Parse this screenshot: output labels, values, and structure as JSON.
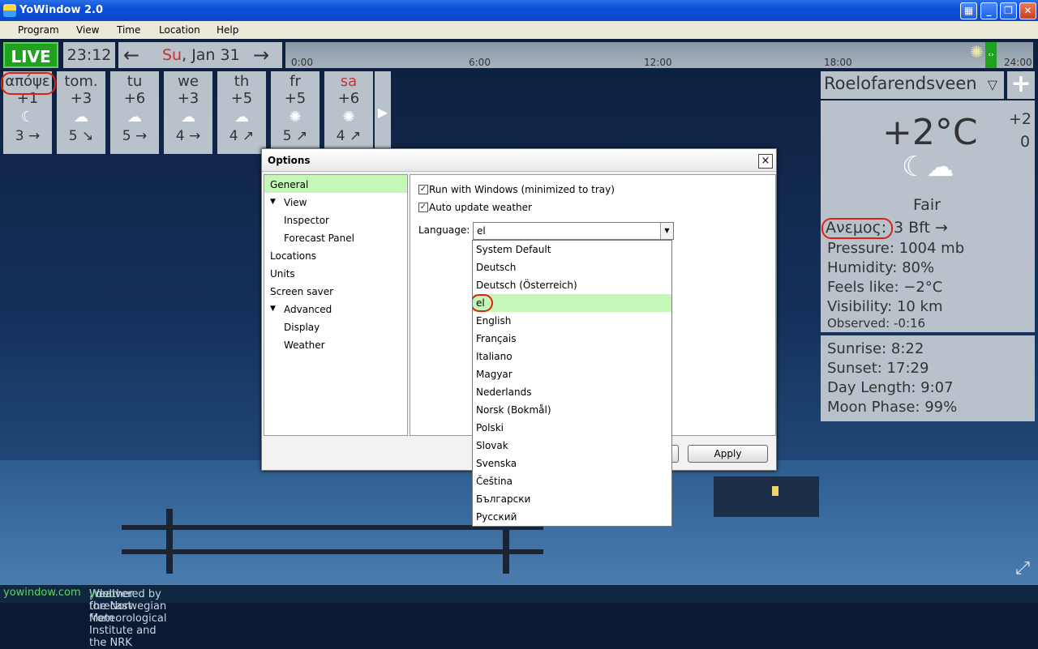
{
  "window": {
    "title": "YoWindow 2.0",
    "minimize": "_",
    "maximize": "❐",
    "close": "✕"
  },
  "menu": [
    "Program",
    "View",
    "Time",
    "Location",
    "Help"
  ],
  "timebar": {
    "live": "LIVE",
    "clock": "23:12",
    "day": "Su",
    "date": ", Jan 31",
    "prev": "←",
    "next": "→",
    "ticks": [
      "0:00",
      "6:00",
      "12:00",
      "18:00",
      "24:00"
    ]
  },
  "forecast": [
    {
      "day": "απόψε",
      "temp": "+1",
      "icon": "☾",
      "wind": "3 →"
    },
    {
      "day": "tom.",
      "temp": "+3",
      "icon": "☁",
      "wind": "5 ↘"
    },
    {
      "day": "tu",
      "temp": "+6",
      "icon": "☁",
      "wind": "5 →"
    },
    {
      "day": "we",
      "temp": "+3",
      "icon": "☁",
      "wind": "4 →"
    },
    {
      "day": "th",
      "temp": "+5",
      "icon": "☁",
      "wind": "4 ↗"
    },
    {
      "day": "fr",
      "temp": "+5",
      "icon": "✺",
      "wind": "5 ↗"
    },
    {
      "day": "sa",
      "temp": "+6",
      "icon": "✺",
      "wind": "4 ↗"
    }
  ],
  "forecast_next": "▶",
  "weather": {
    "location": "Roelofarendsveen",
    "dropdown": "▽",
    "add": "+",
    "temperature": "+2°C",
    "side_top": "+2",
    "side_bottom": "0",
    "icon": "☾☁",
    "condition": "Fair",
    "wind_label": "Ανεμος:",
    "wind_value": "3 Bft →",
    "pressure": "Pressure:  1004 mb",
    "humidity": "Humidity:  80%",
    "feels_like": "Feels like:  −2°C",
    "visibility": "Visibility:  10 km",
    "observed": "Observed:  -0:16",
    "sunrise": "Sunrise:  8:22",
    "sunset": "Sunset:  17:29",
    "day_length": "Day Length:  9:07",
    "moon_phase": "Moon Phase:  99%"
  },
  "dialog": {
    "title": "Options",
    "close": "×",
    "tree": [
      {
        "label": "General",
        "selected": true
      },
      {
        "label": "View",
        "expander": "▼"
      },
      {
        "label": "Inspector"
      },
      {
        "label": "Forecast Panel"
      },
      {
        "label": "Locations"
      },
      {
        "label": "Units"
      },
      {
        "label": "Screen saver"
      },
      {
        "label": "Advanced",
        "expander": "▼"
      },
      {
        "label": "Display"
      },
      {
        "label": "Weather"
      }
    ],
    "run_with_windows": "Run with Windows (minimized to tray)",
    "auto_update": "Auto update weather",
    "checkmark": "✓",
    "language_label": "Language:",
    "language_value": "el",
    "language_button": "▼",
    "languages": [
      "System Default",
      "Deutsch",
      "Deutsch (Österreich)",
      "el",
      "English",
      "Français",
      "Italiano",
      "Magyar",
      "Nederlands",
      "Norsk (Bokmål)",
      "Polski",
      "Slovak",
      "Svenska",
      "Čeština",
      "Български",
      "Русский"
    ],
    "apply": "Apply"
  },
  "status": {
    "site": "yowindow.com",
    "text_prefix": "Weather forecast from ",
    "source": "yr.no",
    "text_suffix": ", delivered by the Norwegian Meteorological Institute and the NRK"
  },
  "expand_icon": "⤢"
}
